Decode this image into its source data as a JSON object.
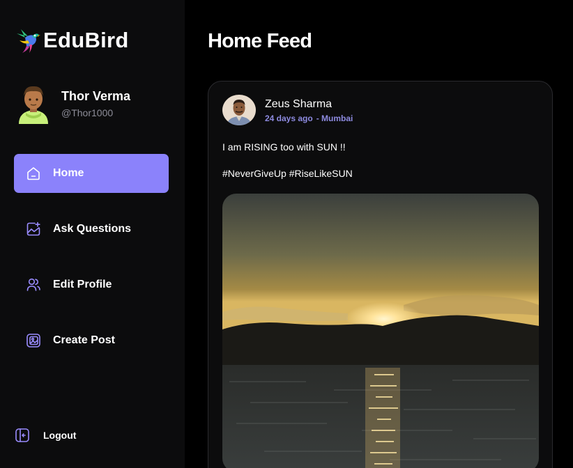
{
  "app": {
    "name": "EduBird"
  },
  "user": {
    "name": "Thor Verma",
    "handle": "@Thor1000"
  },
  "nav": {
    "items": [
      {
        "label": "Home",
        "icon": "home-icon",
        "active": true
      },
      {
        "label": "Ask Questions",
        "icon": "image-plus-icon",
        "active": false
      },
      {
        "label": "Edit Profile",
        "icon": "users-icon",
        "active": false
      },
      {
        "label": "Create Post",
        "icon": "gallery-icon",
        "active": false
      }
    ],
    "logout_label": "Logout"
  },
  "main": {
    "title": "Home Feed"
  },
  "post": {
    "author": "Zeus Sharma",
    "time": "24 days ago",
    "location": "- Mumbai",
    "text": "I am RISING too with SUN !!",
    "tags": "#NeverGiveUp #RiseLikeSUN"
  },
  "colors": {
    "accent": "#8b82fb",
    "meta": "#8d8adf",
    "sidebar_bg": "#0c0c0d"
  }
}
